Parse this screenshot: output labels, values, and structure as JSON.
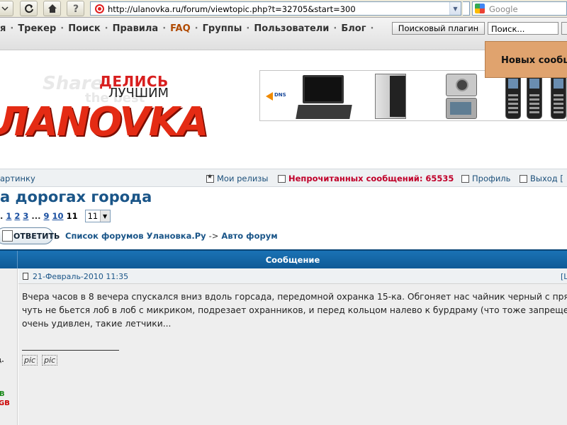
{
  "browser": {
    "url": "http://ulanovka.ru/forum/viewtopic.php?t=32705&start=300",
    "search_placeholder": "Google"
  },
  "site_nav": {
    "items": [
      "я",
      "Трекер",
      "Поиск",
      "Правила",
      "FAQ",
      "Группы",
      "Пользователи",
      "Блог"
    ],
    "separator": "·",
    "plugin_button": "Поисковый плагин",
    "search_value": "Поиск..."
  },
  "popup": {
    "label": "Новых сообщ"
  },
  "logo": {
    "watermark_share": "Share",
    "watermark_best": "the best",
    "tagline_top": "ДЕЛИСЬ",
    "tagline_bottom": "ЛУЧШИМ",
    "name": "ЛANOVKA"
  },
  "banner": {
    "brand": "DNS"
  },
  "user_bar": {
    "left_link": "артинку",
    "my_releases": "Мои релизы",
    "unread_label": "Непрочитанных сообщений: 65535",
    "profile": "Профиль",
    "logout": "Выход ["
  },
  "topic": {
    "title": "а дорогах города",
    "pages": [
      "1",
      "2",
      "3"
    ],
    "pages_ellipsis": "...",
    "pages_late": [
      "9",
      "10"
    ],
    "current_page": "11",
    "lead_dot": ".",
    "page_select_value": "11"
  },
  "actions": {
    "reply_label": "ОТВЕТИТЬ",
    "breadcrumb_forum": "Список форумов Улановка.Ру",
    "breadcrumb_arrow": "->",
    "breadcrumb_section": "Авто форум"
  },
  "table": {
    "header": "Сообщение"
  },
  "author": {
    "fragment_1": "д.",
    "fragment_2": "B",
    "fragment_3": "GB"
  },
  "post": {
    "date": "21-Февраль-2010 11:35",
    "right_link": "[L",
    "lines": [
      "Вчера часов в 8 вечера спускался вниз вдоль горсада, передомной охранка 15-ка. Обгоняет нас чайник черный с прям",
      "чуть не бьется лоб в лоб с микриком, подрезает охранников, и перед кольцом налево к бурдраму (что тоже запрещено",
      "очень удивлен, такие летчики..."
    ],
    "pic_1": "pic",
    "pic_2": "pic"
  }
}
